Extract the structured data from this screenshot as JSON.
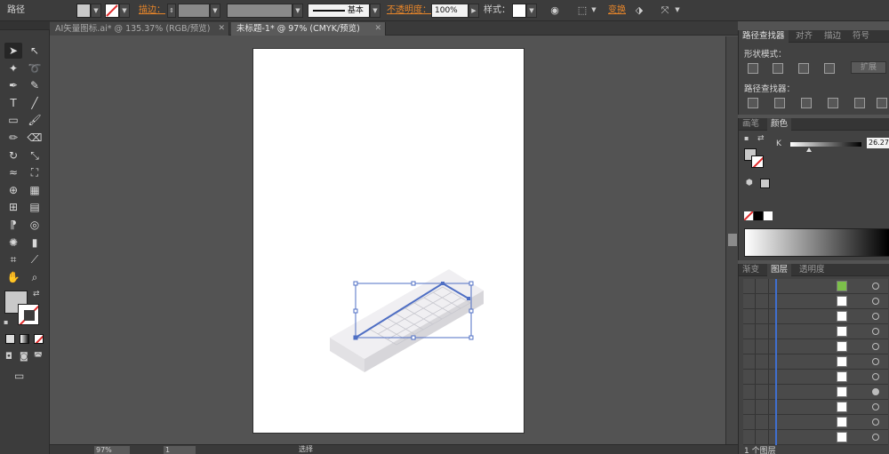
{
  "control_bar": {
    "object_type": "路径",
    "stroke_label": "描边：",
    "stroke_profile": "基本",
    "opacity_label": "不透明度：",
    "opacity_value": "100%",
    "style_label": "样式：",
    "transform_label": "变换"
  },
  "tabs": [
    {
      "label": "AI矢量图标.ai* @ 135.37% (RGB/预览)",
      "active": false
    },
    {
      "label": "未标题-1* @ 97% (CMYK/预览)",
      "active": true
    }
  ],
  "tools": [
    "selection-tool",
    "direct-selection-tool",
    "magic-wand-tool",
    "lasso-tool",
    "pen-tool",
    "curvature-tool",
    "type-tool",
    "line-tool",
    "rectangle-tool",
    "paintbrush-tool",
    "pencil-tool",
    "eraser-tool",
    "rotate-tool",
    "scale-tool",
    "width-tool",
    "free-transform-tool",
    "shape-builder-tool",
    "perspective-grid-tool",
    "mesh-tool",
    "gradient-tool",
    "eyedropper-tool",
    "blend-tool",
    "symbol-sprayer-tool",
    "graph-tool",
    "artboard-tool",
    "slice-tool",
    "hand-tool",
    "zoom-tool"
  ],
  "pathfinder_panel": {
    "tabs": [
      "路径查找器",
      "对齐",
      "描边",
      "符号"
    ],
    "shape_modes_label": "形状模式：",
    "expand_label": "扩展",
    "pathfinder_label": "路径查找器："
  },
  "color_panel": {
    "tabs": [
      "画笔",
      "颜色"
    ],
    "channel_label": "K",
    "channel_value": "26.27",
    "k_slider_level_percent": 26.27
  },
  "layers_panel": {
    "tabs": [
      "渐变",
      "图层",
      "透明度"
    ],
    "layer_count": "1 个图层"
  },
  "status_bar": {
    "zoom": "97%",
    "artboard_number": "1",
    "tool_status": "选择"
  },
  "colors": {
    "accent_orange": "#e8862a",
    "selection_blue": "#4f6fc4",
    "layer_color": "#3f6fcf"
  }
}
